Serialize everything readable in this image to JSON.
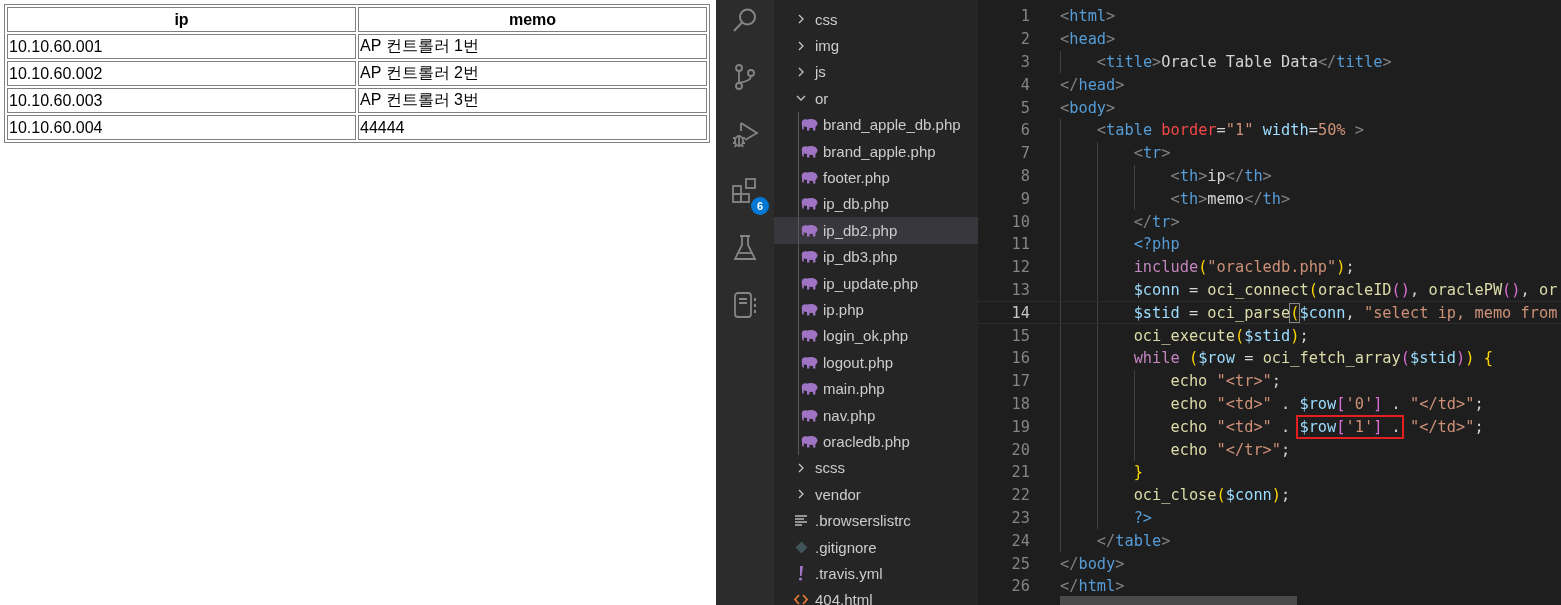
{
  "browser_table": {
    "columns": [
      "ip",
      "memo"
    ],
    "rows": [
      [
        "10.10.60.001",
        "AP 컨트롤러 1번"
      ],
      [
        "10.10.60.002",
        "AP 컨트롤러 2번"
      ],
      [
        "10.10.60.003",
        "AP 컨트롤러 3번"
      ],
      [
        "10.10.60.004",
        "44444"
      ]
    ]
  },
  "activity_bar": [
    {
      "kind": "search"
    },
    {
      "kind": "source-control"
    },
    {
      "kind": "run-debug"
    },
    {
      "kind": "extensions",
      "badge": "6"
    },
    {
      "kind": "testing"
    },
    {
      "kind": "notebook"
    }
  ],
  "explorer": {
    "tree": [
      {
        "kind": "folder",
        "name": "css",
        "expanded": false,
        "selected": false
      },
      {
        "kind": "folder",
        "name": "img",
        "expanded": false,
        "selected": false
      },
      {
        "kind": "folder",
        "name": "js",
        "expanded": false,
        "selected": false
      },
      {
        "kind": "folder",
        "name": "or",
        "expanded": true,
        "selected": false,
        "children": [
          {
            "kind": "php",
            "name": "brand_apple_db.php",
            "selected": false
          },
          {
            "kind": "php",
            "name": "brand_apple.php",
            "selected": false
          },
          {
            "kind": "php",
            "name": "footer.php",
            "selected": false
          },
          {
            "kind": "php",
            "name": "ip_db.php",
            "selected": false
          },
          {
            "kind": "php",
            "name": "ip_db2.php",
            "selected": true
          },
          {
            "kind": "php",
            "name": "ip_db3.php",
            "selected": false
          },
          {
            "kind": "php",
            "name": "ip_update.php",
            "selected": false
          },
          {
            "kind": "php",
            "name": "ip.php",
            "selected": false
          },
          {
            "kind": "php",
            "name": "login_ok.php",
            "selected": false
          },
          {
            "kind": "php",
            "name": "logout.php",
            "selected": false
          },
          {
            "kind": "php",
            "name": "main.php",
            "selected": false
          },
          {
            "kind": "php",
            "name": "nav.php",
            "selected": false
          },
          {
            "kind": "php",
            "name": "oracledb.php",
            "selected": false
          }
        ]
      },
      {
        "kind": "folder",
        "name": "scss",
        "expanded": false,
        "selected": false
      },
      {
        "kind": "folder",
        "name": "vendor",
        "expanded": false,
        "selected": false
      },
      {
        "kind": "text",
        "name": ".browserslistrc",
        "selected": false
      },
      {
        "kind": "git",
        "name": ".gitignore",
        "selected": false
      },
      {
        "kind": "yaml",
        "name": ".travis.yml",
        "selected": false
      },
      {
        "kind": "html",
        "name": "404.html",
        "selected": false
      }
    ]
  },
  "editor": {
    "lines": [
      {
        "n": "1",
        "current": false,
        "tokens": [
          {
            "text": "<",
            "kind": "angle"
          },
          {
            "text": "html",
            "kind": "tag"
          },
          {
            "text": ">",
            "kind": "angle"
          }
        ]
      },
      {
        "n": "2",
        "current": false,
        "tokens": [
          {
            "text": "<",
            "kind": "angle"
          },
          {
            "text": "head",
            "kind": "tag"
          },
          {
            "text": ">",
            "kind": "angle"
          }
        ],
        "children": [
          {
            "n": "3",
            "current": false,
            "tokens": [
              {
                "text": "<",
                "kind": "angle"
              },
              {
                "text": "title",
                "kind": "tag"
              },
              {
                "text": ">",
                "kind": "angle"
              },
              {
                "text": "Oracle Table Data",
                "kind": "plain"
              },
              {
                "text": "</",
                "kind": "angle"
              },
              {
                "text": "title",
                "kind": "tag"
              },
              {
                "text": ">",
                "kind": "angle"
              }
            ]
          }
        ]
      },
      {
        "n": "4",
        "current": false,
        "tokens": [
          {
            "text": "</",
            "kind": "angle"
          },
          {
            "text": "head",
            "kind": "tag"
          },
          {
            "text": ">",
            "kind": "angle"
          }
        ]
      },
      {
        "n": "5",
        "current": false,
        "tokens": [
          {
            "text": "<",
            "kind": "angle"
          },
          {
            "text": "body",
            "kind": "tag"
          },
          {
            "text": ">",
            "kind": "angle"
          }
        ],
        "children": [
          {
            "n": "6",
            "current": false,
            "tokens": [
              {
                "text": "<",
                "kind": "angle"
              },
              {
                "text": "table",
                "kind": "tag"
              },
              {
                "text": " border",
                "kind": "attr-invalid"
              },
              {
                "text": "=",
                "kind": "plain"
              },
              {
                "text": "\"1\"",
                "kind": "string"
              },
              {
                "text": " width",
                "kind": "attr"
              },
              {
                "text": "=",
                "kind": "plain"
              },
              {
                "text": "50%",
                "kind": "string"
              },
              {
                "text": " >",
                "kind": "angle"
              }
            ],
            "children": [
              {
                "n": "7",
                "current": false,
                "tokens": [
                  {
                    "text": "<",
                    "kind": "angle"
                  },
                  {
                    "text": "tr",
                    "kind": "tag"
                  },
                  {
                    "text": ">",
                    "kind": "angle"
                  }
                ],
                "children": [
                  {
                    "n": "8",
                    "current": false,
                    "tokens": [
                      {
                        "text": "<",
                        "kind": "angle"
                      },
                      {
                        "text": "th",
                        "kind": "tag"
                      },
                      {
                        "text": ">",
                        "kind": "angle"
                      },
                      {
                        "text": "ip",
                        "kind": "plain"
                      },
                      {
                        "text": "</",
                        "kind": "angle"
                      },
                      {
                        "text": "th",
                        "kind": "tag"
                      },
                      {
                        "text": ">",
                        "kind": "angle"
                      }
                    ]
                  },
                  {
                    "n": "9",
                    "current": false,
                    "tokens": [
                      {
                        "text": "<",
                        "kind": "angle"
                      },
                      {
                        "text": "th",
                        "kind": "tag"
                      },
                      {
                        "text": ">",
                        "kind": "angle"
                      },
                      {
                        "text": "memo",
                        "kind": "plain"
                      },
                      {
                        "text": "</",
                        "kind": "angle"
                      },
                      {
                        "text": "th",
                        "kind": "tag"
                      },
                      {
                        "text": ">",
                        "kind": "angle"
                      }
                    ]
                  }
                ]
              },
              {
                "n": "10",
                "current": false,
                "tokens": [
                  {
                    "text": "</",
                    "kind": "angle"
                  },
                  {
                    "text": "tr",
                    "kind": "tag"
                  },
                  {
                    "text": ">",
                    "kind": "angle"
                  }
                ]
              },
              {
                "n": "11",
                "current": false,
                "tokens": [
                  {
                    "text": "<?php",
                    "kind": "php"
                  }
                ]
              },
              {
                "n": "12",
                "current": false,
                "tokens": [
                  {
                    "text": "include",
                    "kind": "keyword"
                  },
                  {
                    "text": "(",
                    "kind": "b1"
                  },
                  {
                    "text": "\"oracledb.php\"",
                    "kind": "string"
                  },
                  {
                    "text": ")",
                    "kind": "b1"
                  },
                  {
                    "text": ";",
                    "kind": "plain"
                  }
                ]
              },
              {
                "n": "13",
                "current": false,
                "tokens": [
                  {
                    "text": "$conn",
                    "kind": "var"
                  },
                  {
                    "text": " = ",
                    "kind": "plain"
                  },
                  {
                    "text": "oci_connect",
                    "kind": "func"
                  },
                  {
                    "text": "(",
                    "kind": "b1"
                  },
                  {
                    "text": "oracleID",
                    "kind": "func"
                  },
                  {
                    "text": "()",
                    "kind": "b2"
                  },
                  {
                    "text": ", ",
                    "kind": "plain"
                  },
                  {
                    "text": "oraclePW",
                    "kind": "func"
                  },
                  {
                    "text": "()",
                    "kind": "b2"
                  },
                  {
                    "text": ", ",
                    "kind": "plain"
                  },
                  {
                    "text": "or",
                    "kind": "func"
                  }
                ]
              },
              {
                "n": "14",
                "current": true,
                "tokens": [
                  {
                    "text": "$stid",
                    "kind": "var"
                  },
                  {
                    "text": " = ",
                    "kind": "plain"
                  },
                  {
                    "text": "oci_parse",
                    "kind": "func"
                  },
                  {
                    "text": "(",
                    "kind": "b1",
                    "matched": true
                  },
                  {
                    "text": "$conn",
                    "kind": "var"
                  },
                  {
                    "text": ", ",
                    "kind": "plain"
                  },
                  {
                    "text": "\"select ip, memo from",
                    "kind": "string"
                  }
                ]
              },
              {
                "n": "15",
                "current": false,
                "tokens": [
                  {
                    "text": "oci_execute",
                    "kind": "func"
                  },
                  {
                    "text": "(",
                    "kind": "b1"
                  },
                  {
                    "text": "$stid",
                    "kind": "var"
                  },
                  {
                    "text": ")",
                    "kind": "b1"
                  },
                  {
                    "text": ";",
                    "kind": "plain"
                  }
                ]
              },
              {
                "n": "16",
                "current": false,
                "tokens": [
                  {
                    "text": "while",
                    "kind": "keyword"
                  },
                  {
                    "text": " (",
                    "kind": "b1"
                  },
                  {
                    "text": "$row",
                    "kind": "var"
                  },
                  {
                    "text": " = ",
                    "kind": "plain"
                  },
                  {
                    "text": "oci_fetch_array",
                    "kind": "func"
                  },
                  {
                    "text": "(",
                    "kind": "b2"
                  },
                  {
                    "text": "$stid",
                    "kind": "var"
                  },
                  {
                    "text": ")",
                    "kind": "b2"
                  },
                  {
                    "text": ")",
                    "kind": "b1"
                  },
                  {
                    "text": " {",
                    "kind": "b1"
                  }
                ],
                "children": [
                  {
                    "n": "17",
                    "current": false,
                    "tokens": [
                      {
                        "text": "echo",
                        "kind": "func"
                      },
                      {
                        "text": " \"<tr>\"",
                        "kind": "string"
                      },
                      {
                        "text": ";",
                        "kind": "plain"
                      }
                    ]
                  },
                  {
                    "n": "18",
                    "current": false,
                    "tokens": [
                      {
                        "text": "echo",
                        "kind": "func"
                      },
                      {
                        "text": " \"<td>\"",
                        "kind": "string"
                      },
                      {
                        "text": " . ",
                        "kind": "plain"
                      },
                      {
                        "text": "$row",
                        "kind": "var"
                      },
                      {
                        "text": "[",
                        "kind": "b2"
                      },
                      {
                        "text": "'0'",
                        "kind": "string"
                      },
                      {
                        "text": "]",
                        "kind": "b2"
                      },
                      {
                        "text": " . ",
                        "kind": "plain"
                      },
                      {
                        "text": "\"</td>\"",
                        "kind": "string"
                      },
                      {
                        "text": ";",
                        "kind": "plain"
                      }
                    ]
                  },
                  {
                    "n": "19",
                    "current": false,
                    "tokens": [
                      {
                        "text": "echo",
                        "kind": "func"
                      },
                      {
                        "text": " \"<td>\"",
                        "kind": "string"
                      },
                      {
                        "text": " . ",
                        "kind": "plain"
                      },
                      {
                        "text": "$row",
                        "kind": "var",
                        "boxed": true
                      },
                      {
                        "text": "[",
                        "kind": "b2",
                        "boxed": true
                      },
                      {
                        "text": "'1'",
                        "kind": "string",
                        "boxed": true
                      },
                      {
                        "text": "]",
                        "kind": "b2",
                        "boxed": true
                      },
                      {
                        "text": " .",
                        "kind": "plain",
                        "boxed": true
                      },
                      {
                        "text": " \"</td>\"",
                        "kind": "string"
                      },
                      {
                        "text": ";",
                        "kind": "plain"
                      }
                    ]
                  },
                  {
                    "n": "20",
                    "current": false,
                    "tokens": [
                      {
                        "text": "echo",
                        "kind": "func"
                      },
                      {
                        "text": " \"</tr>\"",
                        "kind": "string"
                      },
                      {
                        "text": ";",
                        "kind": "plain"
                      }
                    ]
                  }
                ]
              },
              {
                "n": "21",
                "current": false,
                "tokens": [
                  {
                    "text": "}",
                    "kind": "b1"
                  }
                ]
              },
              {
                "n": "22",
                "current": false,
                "tokens": [
                  {
                    "text": "oci_close",
                    "kind": "func"
                  },
                  {
                    "text": "(",
                    "kind": "b1"
                  },
                  {
                    "text": "$conn",
                    "kind": "var"
                  },
                  {
                    "text": ")",
                    "kind": "b1"
                  },
                  {
                    "text": ";",
                    "kind": "plain"
                  }
                ]
              },
              {
                "n": "23",
                "current": false,
                "tokens": [
                  {
                    "text": "?>",
                    "kind": "php"
                  }
                ]
              }
            ]
          },
          {
            "n": "24",
            "current": false,
            "tokens": [
              {
                "text": "</",
                "kind": "angle"
              },
              {
                "text": "table",
                "kind": "tag"
              },
              {
                "text": ">",
                "kind": "angle"
              }
            ]
          }
        ]
      },
      {
        "n": "25",
        "current": false,
        "tokens": [
          {
            "text": "</",
            "kind": "angle"
          },
          {
            "text": "body",
            "kind": "tag"
          },
          {
            "text": ">",
            "kind": "angle"
          }
        ]
      },
      {
        "n": "26",
        "current": false,
        "tokens": [
          {
            "text": "</",
            "kind": "angle"
          },
          {
            "text": "html",
            "kind": "tag"
          },
          {
            "text": ">",
            "kind": "angle"
          }
        ]
      }
    ]
  }
}
